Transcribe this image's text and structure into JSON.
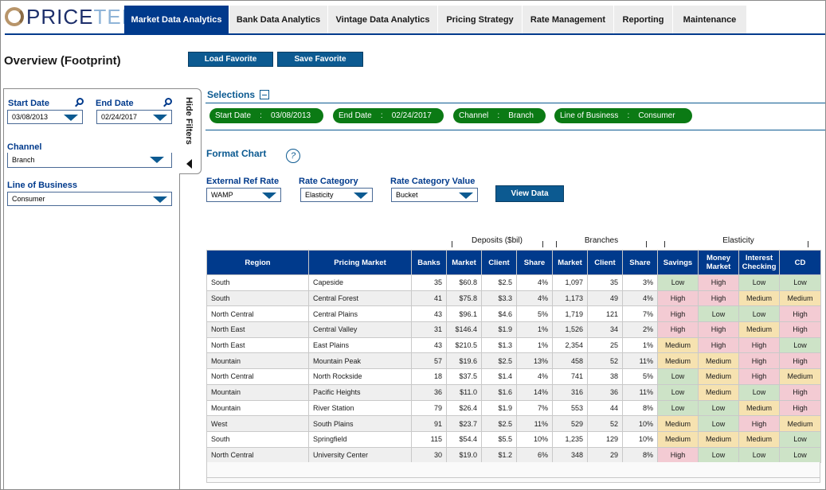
{
  "brand": {
    "name_part1": "PRICE",
    "name_part2": "TEK"
  },
  "nav": {
    "tabs": [
      {
        "label": "Market Data Analytics",
        "active": true
      },
      {
        "label": "Bank Data Analytics",
        "active": false
      },
      {
        "label": "Vintage Data Analytics",
        "active": false
      },
      {
        "label": "Pricing Strategy",
        "active": false
      },
      {
        "label": "Rate Management",
        "active": false
      },
      {
        "label": "Reporting",
        "active": false
      },
      {
        "label": "Maintenance",
        "active": false
      }
    ]
  },
  "page": {
    "title": "Overview (Footprint)"
  },
  "actions": {
    "load_favorite": "Load Favorite",
    "save_favorite": "Save Favorite"
  },
  "filters": {
    "toggle_label": "Hide Filters",
    "start_date": {
      "label": "Start Date",
      "value": "03/08/2013"
    },
    "end_date": {
      "label": "End Date",
      "value": "02/24/2017"
    },
    "channel": {
      "label": "Channel",
      "value": "Branch"
    },
    "line_of_business": {
      "label": "Line of Business",
      "value": "Consumer"
    }
  },
  "selections": {
    "title": "Selections",
    "pills": [
      {
        "key": "Start Date",
        "value": "03/08/2013"
      },
      {
        "key": "End Date",
        "value": "02/24/2017"
      },
      {
        "key": "Channel",
        "value": "Branch"
      },
      {
        "key": "Line of Business",
        "value": "Consumer"
      }
    ]
  },
  "format_chart": {
    "title": "Format Chart",
    "help_icon": "?",
    "external_ref_rate": {
      "label": "External Ref Rate",
      "value": "WAMP"
    },
    "rate_category": {
      "label": "Rate Category",
      "value": "Elasticity"
    },
    "rate_category_value": {
      "label": "Rate Category Value",
      "value": "Bucket"
    },
    "view_data": "View Data"
  },
  "table": {
    "groups": {
      "deposits": "Deposits ($bil)",
      "branches": "Branches",
      "elasticity": "Elasticity"
    },
    "columns": [
      "Region",
      "Pricing Market",
      "Banks",
      "Market",
      "Client",
      "Share",
      "Market",
      "Client",
      "Share",
      "Savings",
      "Money Market",
      "Interest Checking",
      "CD"
    ],
    "rows": [
      [
        "South",
        "Capeside",
        "35",
        "$60.8",
        "$2.5",
        "4%",
        "1,097",
        "35",
        "3%",
        "Low",
        "High",
        "Low",
        "Low"
      ],
      [
        "South",
        "Central Forest",
        "41",
        "$75.8",
        "$3.3",
        "4%",
        "1,173",
        "49",
        "4%",
        "High",
        "High",
        "Medium",
        "Medium"
      ],
      [
        "North Central",
        "Central Plains",
        "43",
        "$96.1",
        "$4.6",
        "5%",
        "1,719",
        "121",
        "7%",
        "High",
        "Low",
        "Low",
        "High"
      ],
      [
        "North East",
        "Central Valley",
        "31",
        "$146.4",
        "$1.9",
        "1%",
        "1,526",
        "34",
        "2%",
        "High",
        "High",
        "Medium",
        "High"
      ],
      [
        "North East",
        "East Plains",
        "43",
        "$210.5",
        "$1.3",
        "1%",
        "2,354",
        "25",
        "1%",
        "Medium",
        "High",
        "High",
        "Low"
      ],
      [
        "Mountain",
        "Mountain Peak",
        "57",
        "$19.6",
        "$2.5",
        "13%",
        "458",
        "52",
        "11%",
        "Medium",
        "Medium",
        "High",
        "High"
      ],
      [
        "North Central",
        "North Rockside",
        "18",
        "$37.5",
        "$1.4",
        "4%",
        "741",
        "38",
        "5%",
        "Low",
        "Medium",
        "High",
        "Medium"
      ],
      [
        "Mountain",
        "Pacific Heights",
        "36",
        "$11.0",
        "$1.6",
        "14%",
        "316",
        "36",
        "11%",
        "Low",
        "Medium",
        "Low",
        "High"
      ],
      [
        "Mountain",
        "River Station",
        "79",
        "$26.4",
        "$1.9",
        "7%",
        "553",
        "44",
        "8%",
        "Low",
        "Low",
        "Medium",
        "High"
      ],
      [
        "West",
        "South Plains",
        "91",
        "$23.7",
        "$2.5",
        "11%",
        "529",
        "52",
        "10%",
        "Medium",
        "Low",
        "High",
        "Medium"
      ],
      [
        "South",
        "Springfield",
        "115",
        "$54.4",
        "$5.5",
        "10%",
        "1,235",
        "129",
        "10%",
        "Medium",
        "Medium",
        "Medium",
        "Low"
      ],
      [
        "North Central",
        "University Center",
        "30",
        "$19.0",
        "$1.2",
        "6%",
        "348",
        "29",
        "8%",
        "High",
        "Low",
        "Low",
        "Low"
      ]
    ]
  },
  "colors": {
    "primary": "#003a8c",
    "button": "#0c5a91",
    "pill": "#0b7a14",
    "low": "#cde3c7",
    "medium": "#f6e2b0",
    "high": "#f3cbd3"
  }
}
